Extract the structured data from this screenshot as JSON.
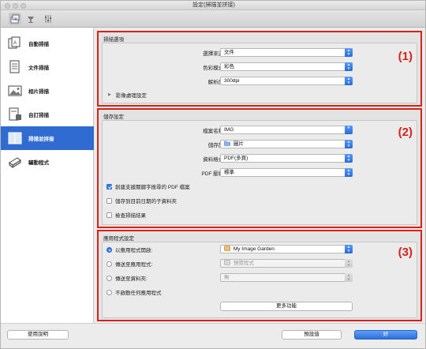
{
  "window": {
    "title": "設定(掃描並拼接)"
  },
  "colors": {
    "accent": "#2f6bd0",
    "highlight_border": "#d8211a"
  },
  "toolbar": {
    "icons": [
      "scan-from-computer-icon",
      "scan-from-panel-icon",
      "general-settings-icon"
    ]
  },
  "sidebar": {
    "items": [
      {
        "label": "自動掃描",
        "icon": "auto-scan-icon"
      },
      {
        "label": "文件掃描",
        "icon": "document-scan-icon"
      },
      {
        "label": "相片掃描",
        "icon": "photo-scan-icon"
      },
      {
        "label": "自訂掃描",
        "icon": "custom-scan-icon"
      },
      {
        "label": "掃描並拼接",
        "icon": "stitch-scan-icon"
      },
      {
        "label": "驅動程式",
        "icon": "driver-icon"
      }
    ]
  },
  "scan_options": {
    "title": "掃描選項",
    "number": "(1)",
    "source_label": "選擇來源:",
    "source_value": "文件",
    "color_label": "色彩模式:",
    "color_value": "彩色",
    "resolution_label": "解析度:",
    "resolution_value": "300dpi",
    "image_processing_label": "影像處理設定"
  },
  "save_settings": {
    "title": "儲存設定",
    "number": "(2)",
    "filename_label": "檔案名稱:",
    "filename_value": "IMG",
    "save_in_label": "儲存於:",
    "save_in_value": "圖片",
    "format_label": "資料格式:",
    "format_value": "PDF(多頁)",
    "compression_label": "PDF 壓縮:",
    "compression_value": "標準",
    "cb_keyword_pdf": "創建支援關鍵字搜尋的 PDF 檔案",
    "cb_keyword_pdf_checked": true,
    "cb_subfolder": "儲存到目前日期的子資料夾",
    "cb_subfolder_checked": false,
    "cb_check_results": "檢查掃描結果",
    "cb_check_results_checked": false
  },
  "app_settings": {
    "title": "應用程式設定",
    "number": "(3)",
    "open_with_label": "以應用程式開啟:",
    "open_with_value": "My Image Garden",
    "send_to_app_label": "傳送至應用程式:",
    "send_to_app_value": "預覽程式",
    "send_to_folder_label": "傳送至資料夾:",
    "send_to_folder_value": "無",
    "no_app_label": "不啟動任何應用程式",
    "more_functions": "更多功能",
    "selected_option": "open_with"
  },
  "footer": {
    "help_button": "使用說明",
    "defaults_button": "預設值",
    "ok_button": "好"
  }
}
